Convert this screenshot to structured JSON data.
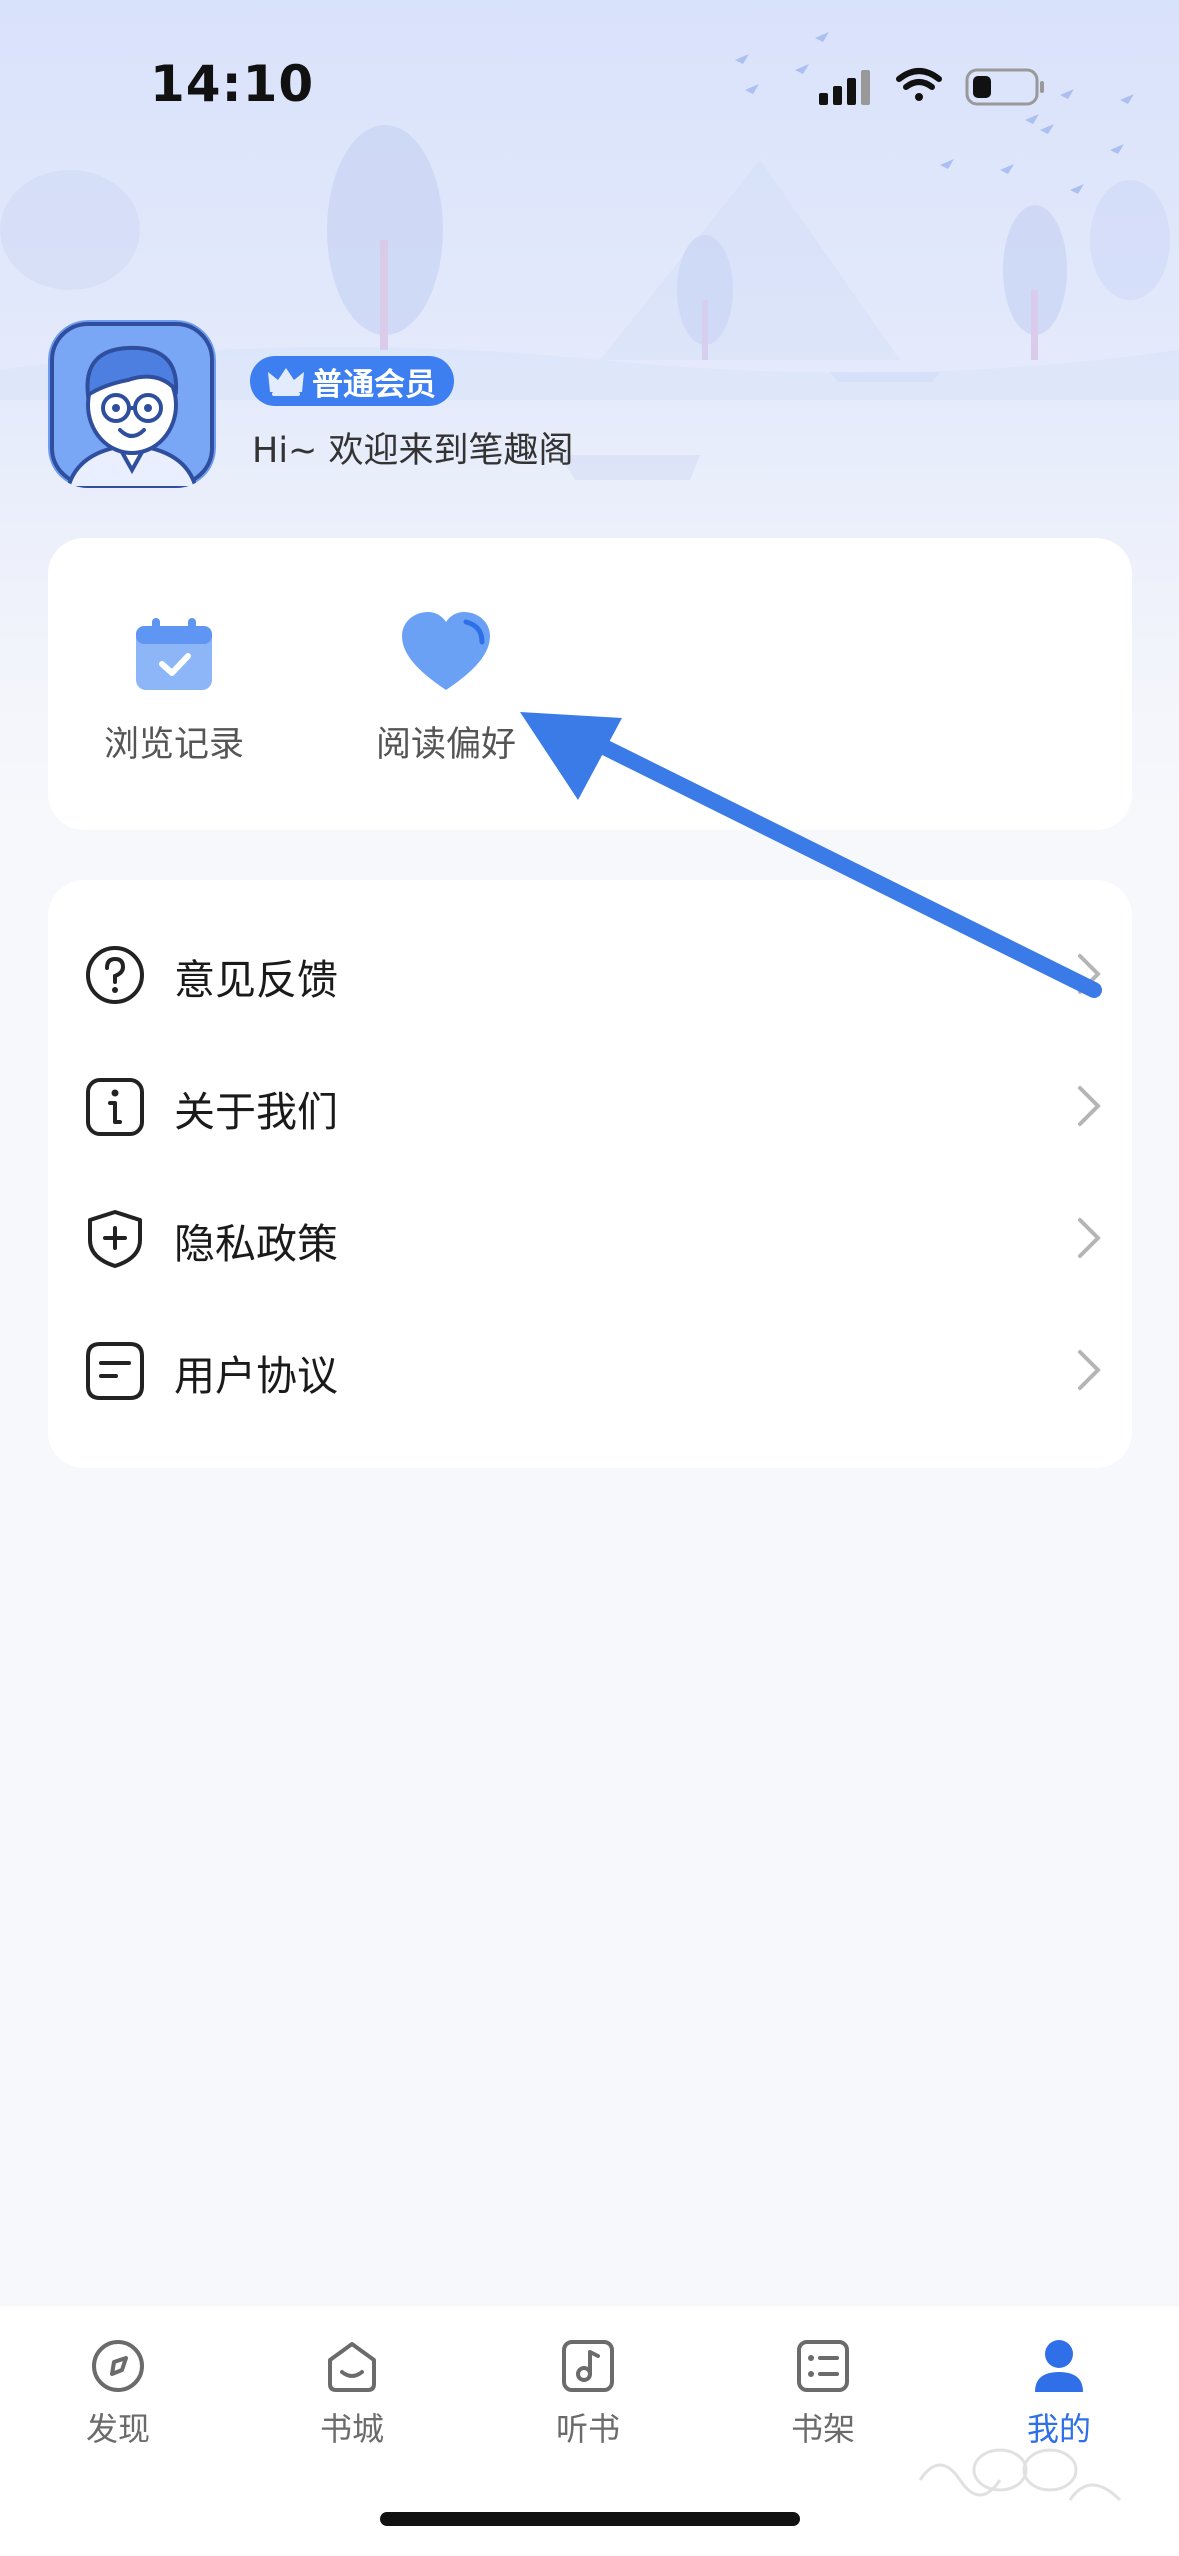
{
  "status": {
    "time": "14:10"
  },
  "profile": {
    "badge": "普通会员",
    "welcome": "Hi~ 欢迎来到笔趣阁"
  },
  "quick_actions": [
    {
      "label": "浏览记录",
      "icon": "calendar-check-icon"
    },
    {
      "label": "阅读偏好",
      "icon": "heart-icon"
    }
  ],
  "menu": [
    {
      "label": "意见反馈",
      "icon": "question-circle-icon"
    },
    {
      "label": "关于我们",
      "icon": "info-icon"
    },
    {
      "label": "隐私政策",
      "icon": "shield-plus-icon"
    },
    {
      "label": "用户协议",
      "icon": "document-icon"
    }
  ],
  "tabbar": [
    {
      "label": "发现",
      "icon": "compass-icon",
      "active": false
    },
    {
      "label": "书城",
      "icon": "bookstore-icon",
      "active": false
    },
    {
      "label": "听书",
      "icon": "music-note-icon",
      "active": false
    },
    {
      "label": "书架",
      "icon": "bookshelf-icon",
      "active": false
    },
    {
      "label": "我的",
      "icon": "user-icon",
      "active": true
    }
  ],
  "colors": {
    "accent": "#2f6fe8",
    "badge": "#3d7ff0",
    "annotation_arrow": "#3b7be8"
  }
}
